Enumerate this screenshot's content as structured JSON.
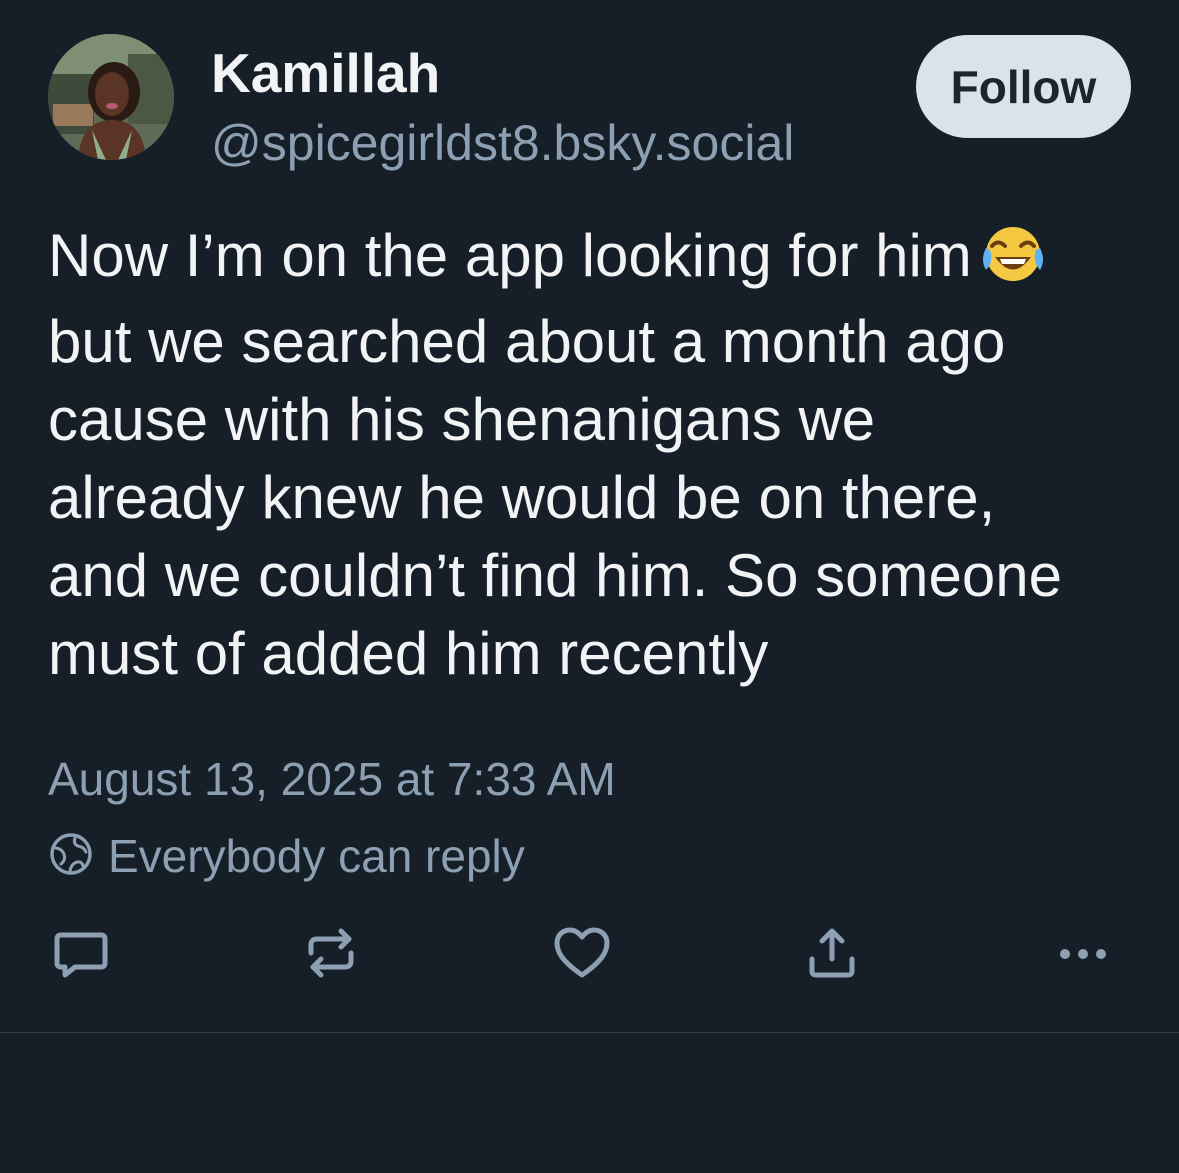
{
  "author": {
    "display_name": "Kamillah",
    "handle": "@spicegirldst8.bsky.social",
    "avatar_icon": "profile-photo"
  },
  "follow_label": "Follow",
  "post": {
    "lines": [
      "Now I’m on the app looking for him",
      "but we searched about a month ago",
      "cause with his shenanigans we",
      "already knew he would be on there,",
      "and we couldn’t find him. So someone",
      "must of added him recently"
    ],
    "emoji": "😂"
  },
  "timestamp": "August 13, 2025 at 7:33 AM",
  "reply_setting": {
    "label": "Everybody can reply",
    "icon": "globe-icon"
  },
  "actions": [
    "reply-icon",
    "repost-icon",
    "like-icon",
    "share-icon",
    "more-icon"
  ],
  "colors": {
    "background": "#161e27",
    "text": "#f1f3f5",
    "muted": "#8d9fb3",
    "follow_bg": "#dce2ea"
  }
}
